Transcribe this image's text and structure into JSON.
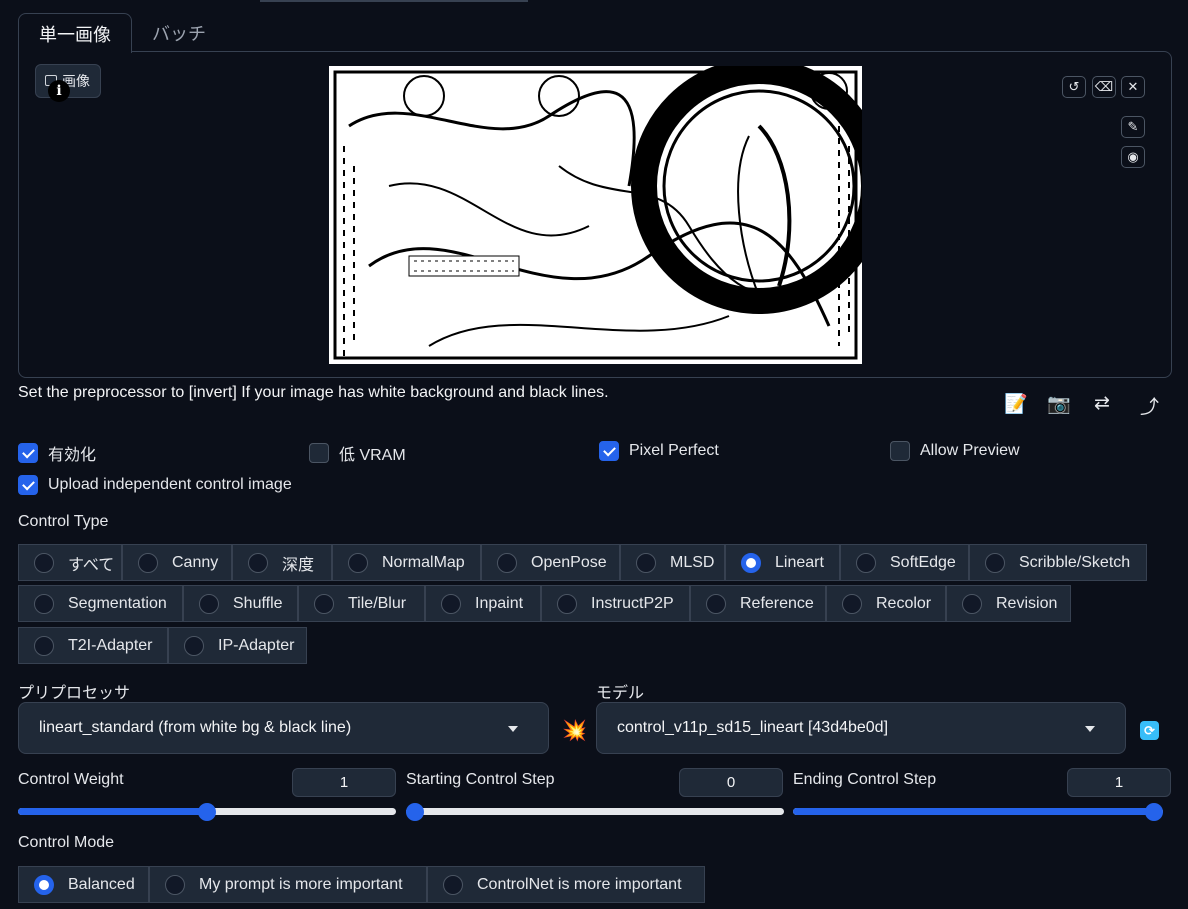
{
  "tabs": [
    {
      "label": "単一画像",
      "active": true
    },
    {
      "label": "バッチ",
      "active": false
    }
  ],
  "image_panel": {
    "label": "画像",
    "info": "i",
    "tools": {
      "undo": "↺",
      "erase": "⌫",
      "close": "✕",
      "brush": "✎",
      "palette": "◉"
    }
  },
  "hint": "Set the preprocessor to [invert] If your image has white background and black lines.",
  "action_icons": {
    "edit": "📝",
    "camera": "📷",
    "swap": "⇄",
    "send": "⤴"
  },
  "checkboxes": [
    {
      "label": "有効化",
      "checked": true
    },
    {
      "label": "低 VRAM",
      "checked": false
    },
    {
      "label": "Pixel Perfect",
      "checked": true
    },
    {
      "label": "Allow Preview",
      "checked": false
    },
    {
      "label": "Upload independent control image",
      "checked": true
    }
  ],
  "control_type": {
    "label": "Control Type",
    "options": [
      "すべて",
      "Canny",
      "深度",
      "NormalMap",
      "OpenPose",
      "MLSD",
      "Lineart",
      "SoftEdge",
      "Scribble/Sketch",
      "Segmentation",
      "Shuffle",
      "Tile/Blur",
      "Inpaint",
      "InstructP2P",
      "Reference",
      "Recolor",
      "Revision",
      "T2I-Adapter",
      "IP-Adapter"
    ],
    "selected": "Lineart"
  },
  "preprocessor": {
    "label": "プリプロセッサ",
    "value": "lineart_standard (from white bg & black line)"
  },
  "model": {
    "label": "モデル",
    "value": "control_v11p_sd15_lineart [43d4be0d]"
  },
  "icons": {
    "run": "💥",
    "refresh": "⟳"
  },
  "sliders": [
    {
      "label": "Control Weight",
      "value": "1",
      "fraction": 0.5
    },
    {
      "label": "Starting Control Step",
      "value": "0",
      "fraction": 0.0
    },
    {
      "label": "Ending Control Step",
      "value": "1",
      "fraction": 1.0
    }
  ],
  "control_mode": {
    "label": "Control Mode",
    "options": [
      "Balanced",
      "My prompt is more important",
      "ControlNet is more important"
    ],
    "selected": "Balanced"
  },
  "colors": {
    "accent": "#2563eb",
    "background": "#0b0f19",
    "panel": "#1f2937",
    "border": "#374151"
  }
}
